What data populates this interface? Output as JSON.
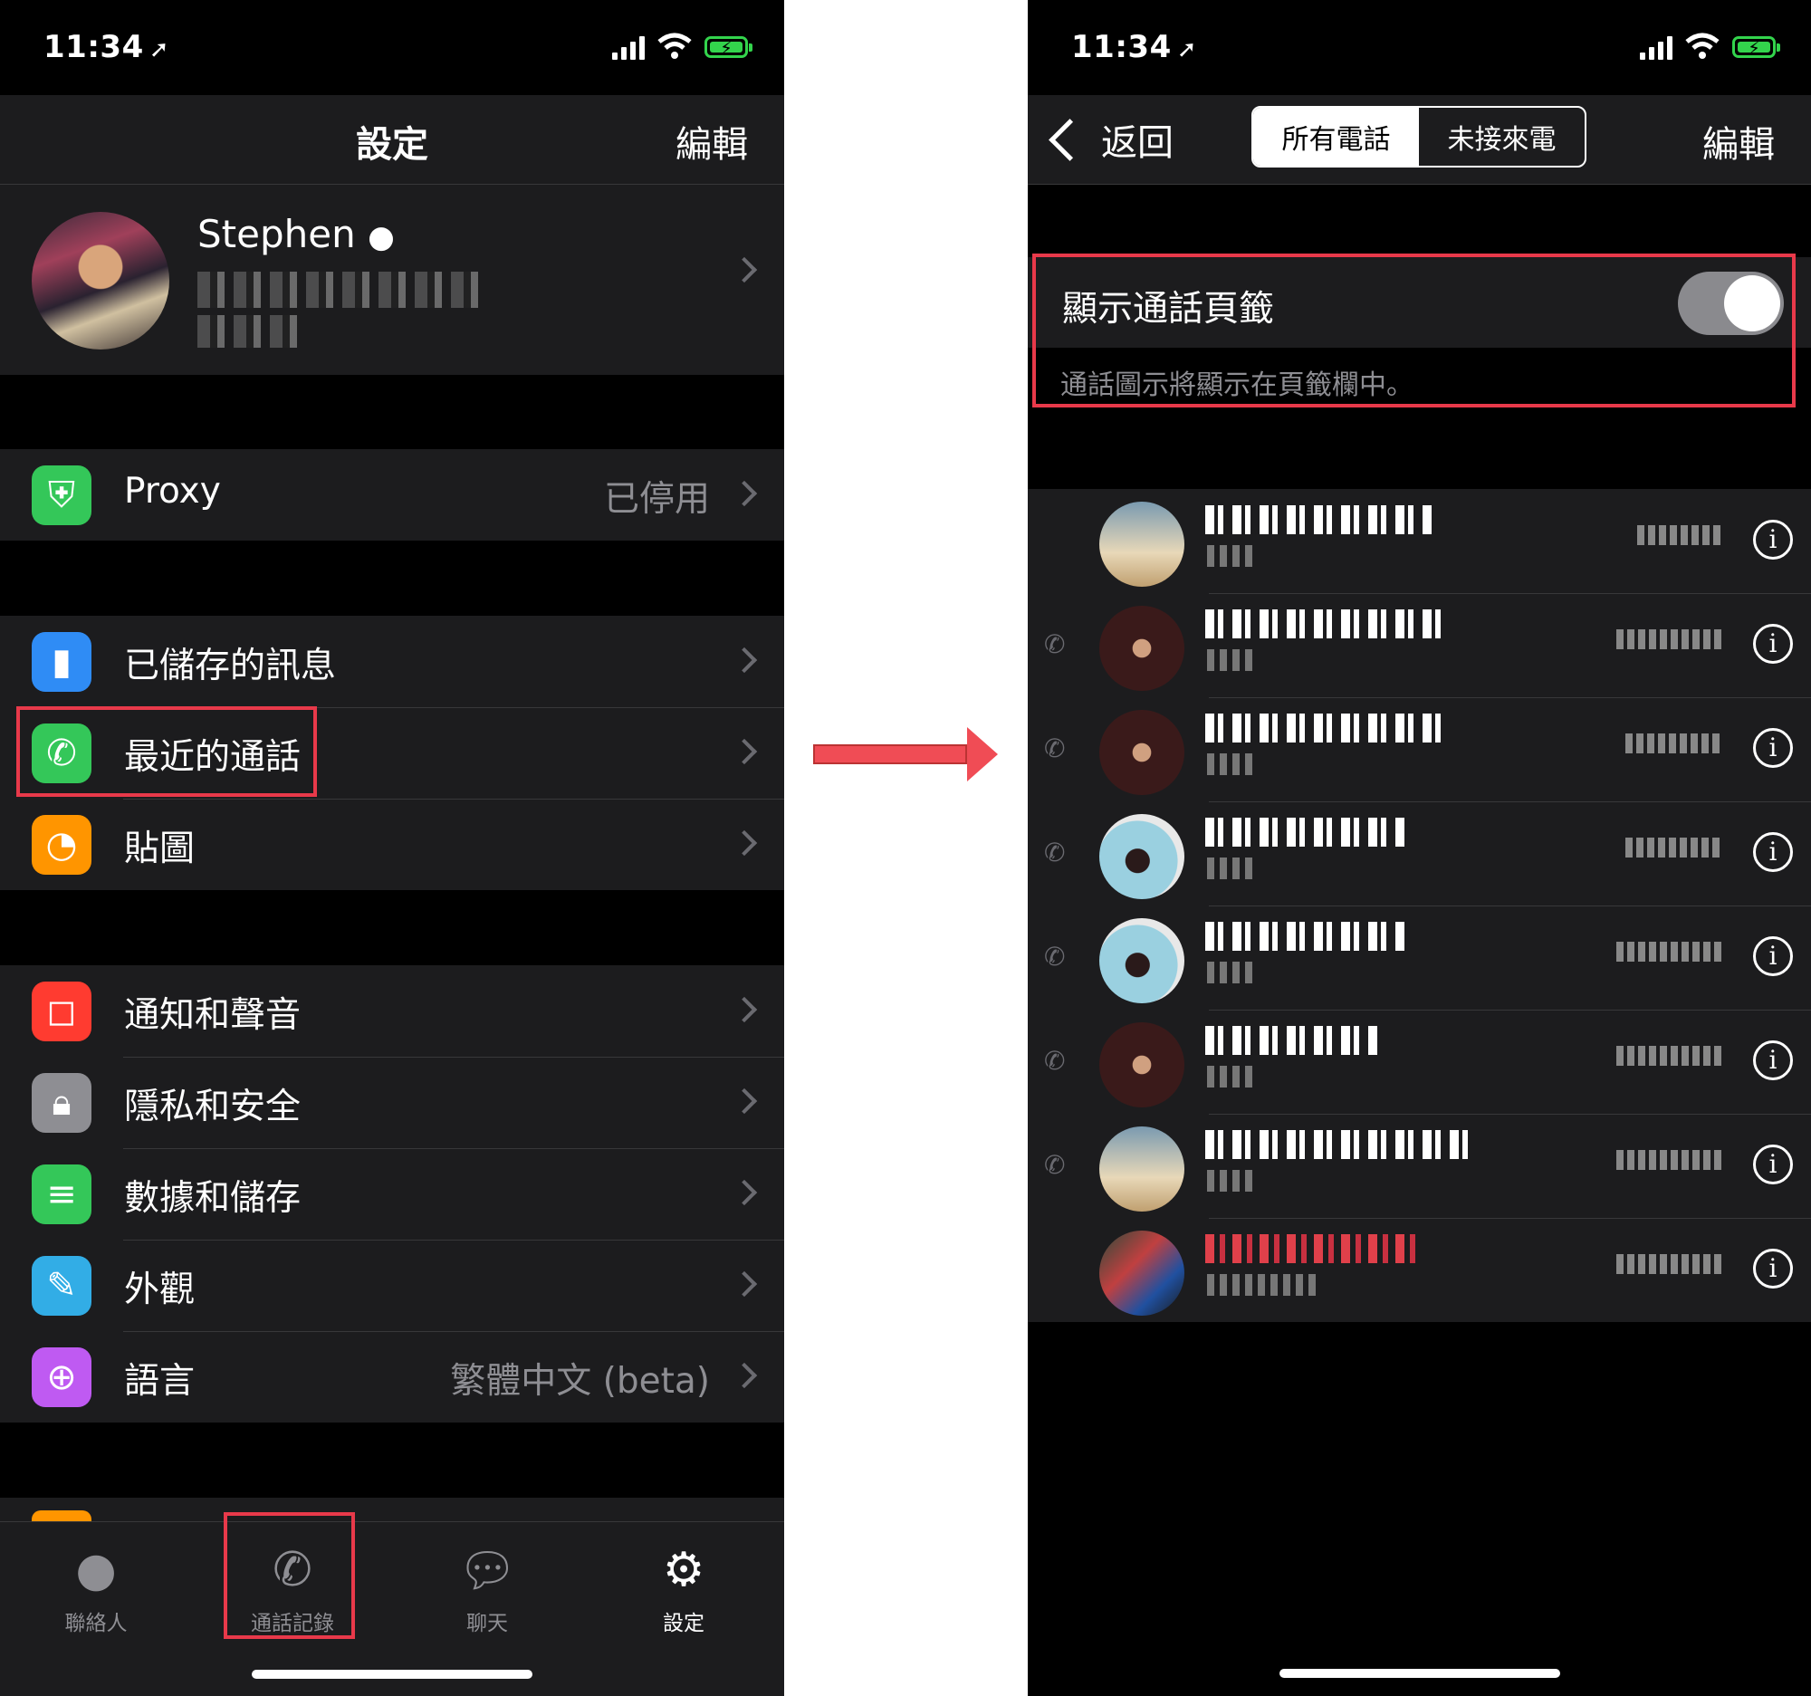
{
  "left": {
    "status": {
      "time": "11:34"
    },
    "nav": {
      "title": "設定",
      "edit": "編輯"
    },
    "profile": {
      "name": "Stephen "
    },
    "proxy": {
      "label": "Proxy",
      "value": "已停用"
    },
    "group2": [
      {
        "label": "已儲存的訊息"
      },
      {
        "label": "最近的通話"
      },
      {
        "label": "貼圖"
      }
    ],
    "group3": [
      {
        "label": "通知和聲音"
      },
      {
        "label": "隱私和安全"
      },
      {
        "label": "數據和儲存"
      },
      {
        "label": "外觀"
      },
      {
        "label": "語言",
        "value": "繁體中文 (beta)"
      }
    ],
    "tabs": [
      {
        "label": "聯絡人",
        "icon": "person-icon"
      },
      {
        "label": "通話記錄",
        "icon": "phone-icon"
      },
      {
        "label": "聊天",
        "icon": "chat-bubbles-icon"
      },
      {
        "label": "設定",
        "icon": "gear-icon",
        "active": true
      }
    ]
  },
  "right": {
    "status": {
      "time": "11:34"
    },
    "nav": {
      "back": "返回",
      "seg_all": "所有電話",
      "seg_missed": "未接來電",
      "edit": "編輯"
    },
    "toggle": {
      "label": "顯示通話頁籤",
      "on": true
    },
    "footer": "通話圖示將顯示在頁籤欄中。"
  },
  "colors": {
    "accent_red": "#e8394a",
    "arrow": "#f04c55",
    "toggle_track": "#8a8a8e"
  }
}
